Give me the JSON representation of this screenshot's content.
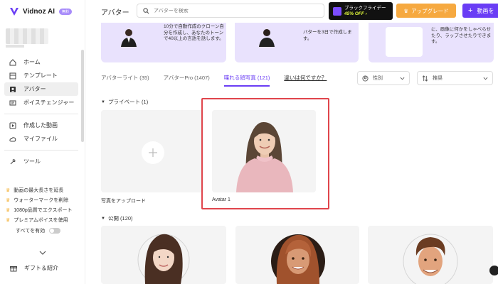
{
  "brand": {
    "name": "Vidnoz AI",
    "badge": "無料"
  },
  "header": {
    "title": "アバター",
    "search_placeholder": "アバターを検索",
    "black_friday_line1": "ブラックフライデー",
    "black_friday_line2": "45% OFF ›",
    "upgrade_label": "アップグレード",
    "make_label": "動画を"
  },
  "sidebar": {
    "items": [
      {
        "label": "ホーム",
        "icon": "home-icon"
      },
      {
        "label": "テンプレート",
        "icon": "template-icon"
      },
      {
        "label": "アバター",
        "icon": "avatar-icon",
        "active": true
      },
      {
        "label": "ボイスチェンジャー",
        "icon": "voice-changer-icon"
      },
      {
        "label": "作成した動画",
        "icon": "video-icon"
      },
      {
        "label": "マイファイル",
        "icon": "cloud-icon"
      },
      {
        "label": "ツール",
        "icon": "tools-icon"
      }
    ],
    "promos": [
      "動画の最大長さを延長",
      "ウォーターマークを削除",
      "1080p品質でエクスポート",
      "プレミアムボイスを使用"
    ],
    "enable_all": "すべてを有効",
    "gift": "ギフト＆紹介"
  },
  "banners": [
    {
      "text": "10分で自動作成のクローン自分を作成し、あなたのトーンで40以上の言語を話します。"
    },
    {
      "text": "バターを3日で作成します。"
    },
    {
      "text": "に、画像に何かをしゃべらせたり、ラップさせたりできます。"
    }
  ],
  "tabs": [
    {
      "label": "アバターライト (35)"
    },
    {
      "label": "アバターPro (1407)"
    },
    {
      "label": "喋れる顔写真 (121)",
      "active": true
    },
    {
      "label": "違いは何ですか？",
      "link": true
    }
  ],
  "filters": {
    "gender": "性別",
    "sort": "推奨"
  },
  "private_section": {
    "title": "プライベート (1)",
    "upload_label": "写真をアップロード",
    "avatar_label": "Avatar 1"
  },
  "public_section": {
    "title": "公開 (120)"
  },
  "colors": {
    "accent": "#6a3df5",
    "highlight": "#e0454c",
    "upgrade": "#f6a940"
  }
}
